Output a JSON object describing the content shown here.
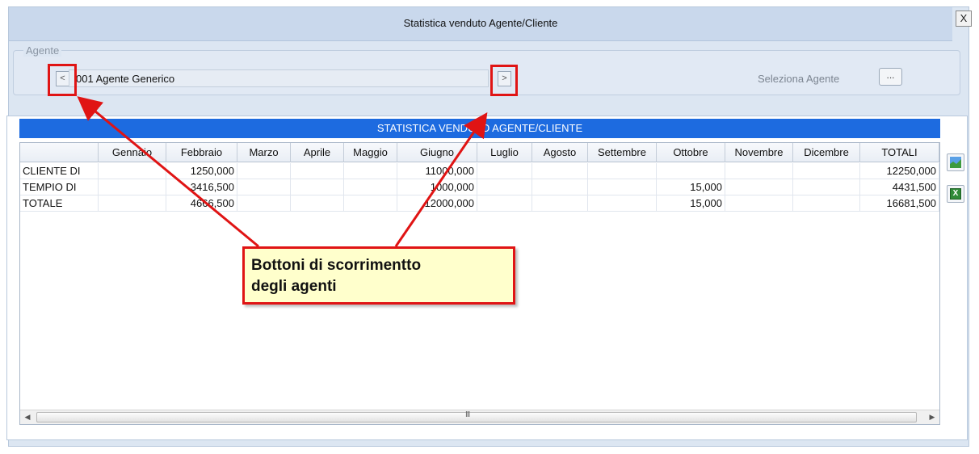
{
  "window": {
    "title": "Statistica venduto Agente/Cliente",
    "close_label": "X"
  },
  "agent": {
    "legend": "Agente",
    "prev_label": "<",
    "next_label": ">",
    "value": "001 Agente Generico",
    "select_label": "Seleziona Agente",
    "select_button_label": "..."
  },
  "table": {
    "header": "STATISTICA VENDUTO AGENTE/CLIENTE",
    "columns": [
      "",
      "Gennaio",
      "Febbraio",
      "Marzo",
      "Aprile",
      "Maggio",
      "Giugno",
      "Luglio",
      "Agosto",
      "Settembre",
      "Ottobre",
      "Novembre",
      "Dicembre",
      "TOTALI"
    ],
    "rows": [
      [
        "CLIENTE DI",
        "",
        "1250,000",
        "",
        "",
        "",
        "11000,000",
        "",
        "",
        "",
        "",
        "",
        "",
        "12250,000"
      ],
      [
        "TEMPIO DI",
        "",
        "3416,500",
        "",
        "",
        "",
        "1000,000",
        "",
        "",
        "",
        "15,000",
        "",
        "",
        "4431,500"
      ],
      [
        "TOTALE",
        "",
        "4666,500",
        "",
        "",
        "",
        "12000,000",
        "",
        "",
        "",
        "15,000",
        "",
        "",
        "16681,500"
      ]
    ]
  },
  "side_buttons": {
    "chart_icon": "chart-icon",
    "excel_icon": "excel-icon",
    "excel_glyph": "X"
  },
  "annotation": {
    "line1": "Bottoni di scorrimentto",
    "line2": "degli agenti",
    "color": "#e01414"
  },
  "scrollbar": {
    "grip": "III"
  }
}
